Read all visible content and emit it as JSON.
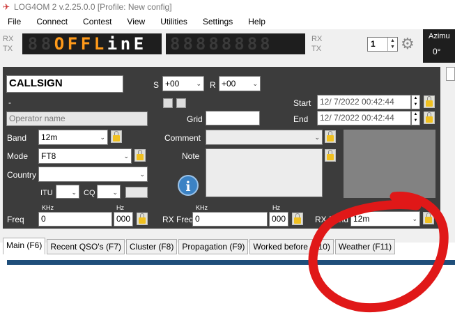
{
  "window": {
    "title": "LOG4OM 2 v.2.25.0.0 [Profile: New config]"
  },
  "menu": [
    "File",
    "Connect",
    "Contest",
    "View",
    "Utilities",
    "Settings",
    "Help"
  ],
  "display": {
    "rx": "RX",
    "tx": "TX",
    "dim_digits": "88",
    "text_chars": [
      "O",
      "F",
      "F",
      "L",
      "i",
      "n",
      "E"
    ],
    "dim_digits2": "88888888",
    "rx2": "RX",
    "tx2": "TX",
    "radio_number": "1",
    "azimuth_label": "Azimu",
    "azimuth_value": "0°",
    "led_color": "#ff9a1a"
  },
  "qso": {
    "callsign_value": "CALLSIGN",
    "callsign_sub": "-",
    "operator_placeholder": "Operator name",
    "s_label": "S",
    "s_value": "+00",
    "r_label": "R",
    "r_value": "+00",
    "start_label": "Start",
    "start_value": "12/  7/2022 00:42:44",
    "end_label": "End",
    "end_value": "12/  7/2022 00:42:44",
    "grid_label": "Grid",
    "grid_value": "",
    "band_label": "Band",
    "band_value": "12m",
    "mode_label": "Mode",
    "mode_value": "FT8",
    "country_label": "Country",
    "country_value": "",
    "itu_label": "ITU",
    "cq_label": "CQ",
    "comment_label": "Comment",
    "comment_value": "",
    "note_label": "Note",
    "note_value": "",
    "khz_label": "KHz",
    "hz_label": "Hz",
    "freq_label": "Freq",
    "freq_value": "0",
    "freq_hz": "000",
    "rxfreq_label": "RX Freq",
    "rxfreq_value": "0",
    "rxfreq_hz": "000",
    "rxband_label": "RX Band",
    "rxband_value": "12m",
    "info_icon": "info-icon"
  },
  "tabs": [
    "Main (F6)",
    "Recent QSO's (F7)",
    "Cluster (F8)",
    "Propagation (F9)",
    "Worked before (F10)",
    "Weather (F11)"
  ],
  "colors": {
    "panel": "#3c3c3c",
    "annotation": "#e01818",
    "strip": "#1f4e7a"
  }
}
